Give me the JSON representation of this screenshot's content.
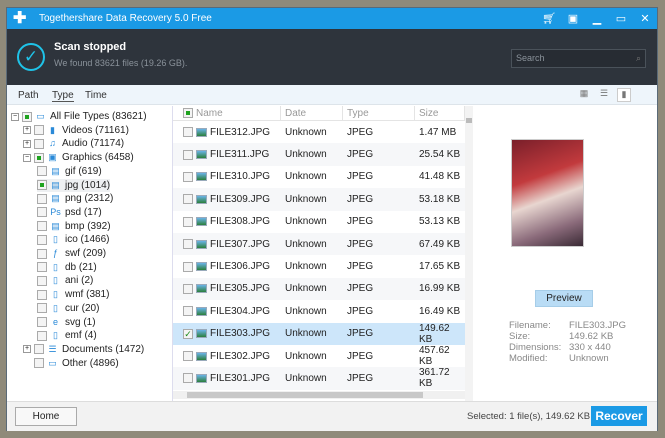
{
  "window": {
    "title": "Togethershare Data Recovery 5.0 Free"
  },
  "header": {
    "status": "Scan stopped",
    "summary": "We found 83621 files (19.26 GB).",
    "search_placeholder": "Search"
  },
  "tabs": [
    "Path",
    "Type",
    "Time"
  ],
  "tree": [
    {
      "label": "All File Types (83621)",
      "level": 0,
      "exp": "−",
      "checked": true,
      "icon": "▭"
    },
    {
      "label": "Videos (71161)",
      "level": 1,
      "exp": "+",
      "checked": false,
      "icon": "▮"
    },
    {
      "label": "Audio (71174)",
      "level": 1,
      "exp": "+",
      "checked": false,
      "icon": "♫"
    },
    {
      "label": "Graphics (6458)",
      "level": 1,
      "exp": "−",
      "checked": true,
      "icon": "▣"
    },
    {
      "label": "gif (619)",
      "level": 2,
      "checked": false,
      "icon": "▤"
    },
    {
      "label": "jpg (1014)",
      "level": 2,
      "checked": true,
      "icon": "▤"
    },
    {
      "label": "png (2312)",
      "level": 2,
      "checked": false,
      "icon": "▤"
    },
    {
      "label": "psd (17)",
      "level": 2,
      "checked": false,
      "icon": "Ps"
    },
    {
      "label": "bmp (392)",
      "level": 2,
      "checked": false,
      "icon": "▤"
    },
    {
      "label": "ico (1466)",
      "level": 2,
      "checked": false,
      "icon": "▯"
    },
    {
      "label": "swf (209)",
      "level": 2,
      "checked": false,
      "icon": "ƒ"
    },
    {
      "label": "db (21)",
      "level": 2,
      "checked": false,
      "icon": "▯"
    },
    {
      "label": "ani (2)",
      "level": 2,
      "checked": false,
      "icon": "▯"
    },
    {
      "label": "wmf (381)",
      "level": 2,
      "checked": false,
      "icon": "▯"
    },
    {
      "label": "cur (20)",
      "level": 2,
      "checked": false,
      "icon": "▯"
    },
    {
      "label": "svg (1)",
      "level": 2,
      "checked": false,
      "icon": "e"
    },
    {
      "label": "emf (4)",
      "level": 2,
      "checked": false,
      "icon": "▯"
    },
    {
      "label": "Documents (1472)",
      "level": 1,
      "exp": "+",
      "checked": false,
      "icon": "☰"
    },
    {
      "label": "Other (4896)",
      "level": 1,
      "exp": "",
      "checked": false,
      "icon": "▭"
    }
  ],
  "list": {
    "columns": [
      "Name",
      "Date",
      "Type",
      "Size"
    ],
    "rows": [
      [
        "FILE312.JPG",
        "Unknown",
        "JPEG",
        "1.47 MB"
      ],
      [
        "FILE311.JPG",
        "Unknown",
        "JPEG",
        "25.54 KB"
      ],
      [
        "FILE310.JPG",
        "Unknown",
        "JPEG",
        "41.48 KB"
      ],
      [
        "FILE309.JPG",
        "Unknown",
        "JPEG",
        "53.18 KB"
      ],
      [
        "FILE308.JPG",
        "Unknown",
        "JPEG",
        "53.13 KB"
      ],
      [
        "FILE307.JPG",
        "Unknown",
        "JPEG",
        "67.49 KB"
      ],
      [
        "FILE306.JPG",
        "Unknown",
        "JPEG",
        "17.65 KB"
      ],
      [
        "FILE305.JPG",
        "Unknown",
        "JPEG",
        "16.99 KB"
      ],
      [
        "FILE304.JPG",
        "Unknown",
        "JPEG",
        "16.49 KB"
      ],
      [
        "FILE303.JPG",
        "Unknown",
        "JPEG",
        "149.62 KB"
      ],
      [
        "FILE302.JPG",
        "Unknown",
        "JPEG",
        "457.62 KB"
      ],
      [
        "FILE301.JPG",
        "Unknown",
        "JPEG",
        "361.72 KB"
      ]
    ],
    "selected_index": 9
  },
  "preview": {
    "button": "Preview",
    "labels": [
      "Filename:",
      "Size:",
      "Dimensions:",
      "Modified:"
    ],
    "values": [
      "FILE303.JPG",
      "149.62 KB",
      "330 x 440",
      "Unknown"
    ]
  },
  "footer": {
    "home": "Home",
    "selected": "Selected: 1 file(s), 149.62 KB",
    "recover": "Recover"
  }
}
